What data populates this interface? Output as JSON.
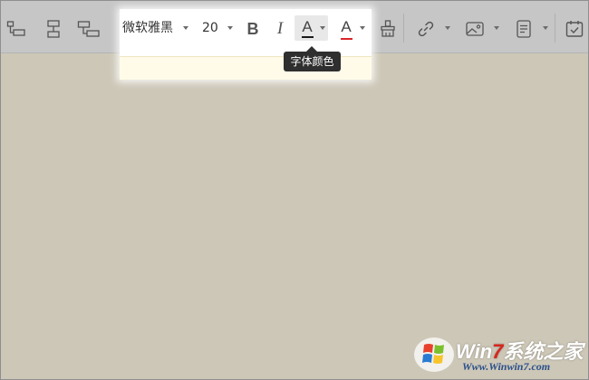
{
  "toolbar": {
    "left_icons": [
      "merge-cells-icon",
      "split-cells-icon",
      "flow-node-icon"
    ],
    "font_family": {
      "value": "微软雅黑"
    },
    "font_size": {
      "value": "20"
    },
    "bold": {
      "label": "B"
    },
    "italic": {
      "label": "I"
    },
    "font_color": {
      "label": "A",
      "color": "#1a1a1a"
    },
    "highlight_color": {
      "label": "A",
      "color": "#d9262a"
    },
    "right_icons": [
      "format-painter-icon",
      "link-icon",
      "image-icon",
      "paragraph-icon",
      "calendar-icon"
    ]
  },
  "tooltip": {
    "text": "字体颜色"
  },
  "watermark": {
    "brand_prefix": "Win",
    "brand_seven": "7",
    "brand_suffix": "系统之家",
    "url": "Www.Winwin7.com"
  },
  "colors": {
    "toolbar_bg": "#c6c6c6",
    "page_bg": "#cdc7b7",
    "highlight_bg": "#ffffff",
    "edit_strip": "#fffbe8",
    "tooltip_bg": "#2f2f2f"
  }
}
